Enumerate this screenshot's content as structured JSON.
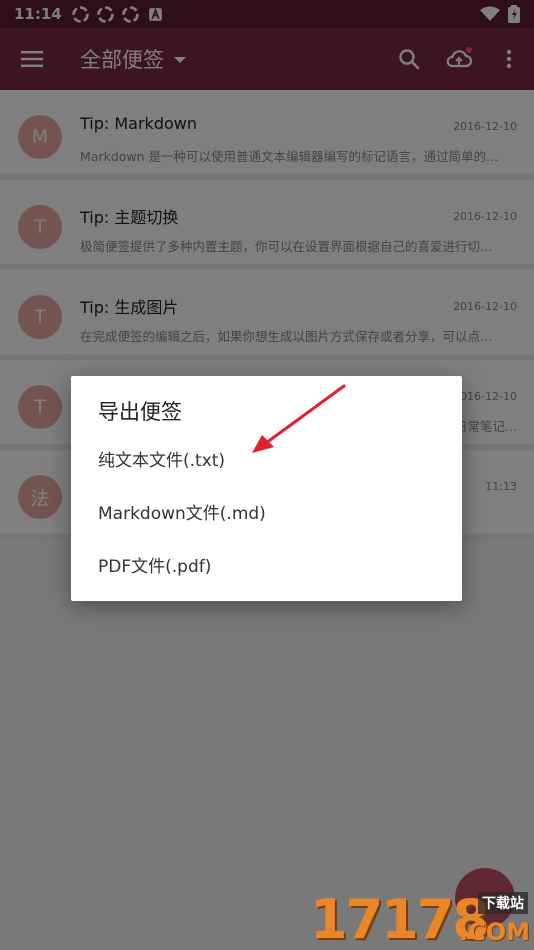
{
  "status_bar": {
    "time": "11:14"
  },
  "app_bar": {
    "title": "全部便签"
  },
  "notes": [
    {
      "avatar": "M",
      "title": "Tip: Markdown",
      "date": "2016-12-10",
      "preview": "Markdown 是一种可以使用普通文本编辑器编写的标记语言，通过简单的…"
    },
    {
      "avatar": "T",
      "title": "Tip: 主题切换",
      "date": "2016-12-10",
      "preview": "极简便签提供了多种内置主题，你可以在设置界面根据自己的喜爱进行切…"
    },
    {
      "avatar": "T",
      "title": "Tip: 生成图片",
      "date": "2016-12-10",
      "preview": "在完成便签的编辑之后，如果你想生成以图片方式保存或者分享，可以点…"
    },
    {
      "avatar": "T",
      "title": "",
      "date": "2016-12-10",
      "preview": "日常笔记…"
    },
    {
      "avatar": "法",
      "title": "",
      "date": "11:13",
      "preview": ""
    }
  ],
  "dialog": {
    "title": "导出便签",
    "options": [
      {
        "label": "纯文本文件(.txt)"
      },
      {
        "label": "Markdown文件(.md)"
      },
      {
        "label": "PDF文件(.pdf)"
      }
    ]
  },
  "watermark": {
    "number": "17178",
    "site": "下载站",
    "domain": ".COM"
  },
  "colors": {
    "app_bar": "#7a2b45",
    "avatar": "#e8a8a0",
    "arrow": "#e0202a",
    "fab": "#b8344f"
  }
}
